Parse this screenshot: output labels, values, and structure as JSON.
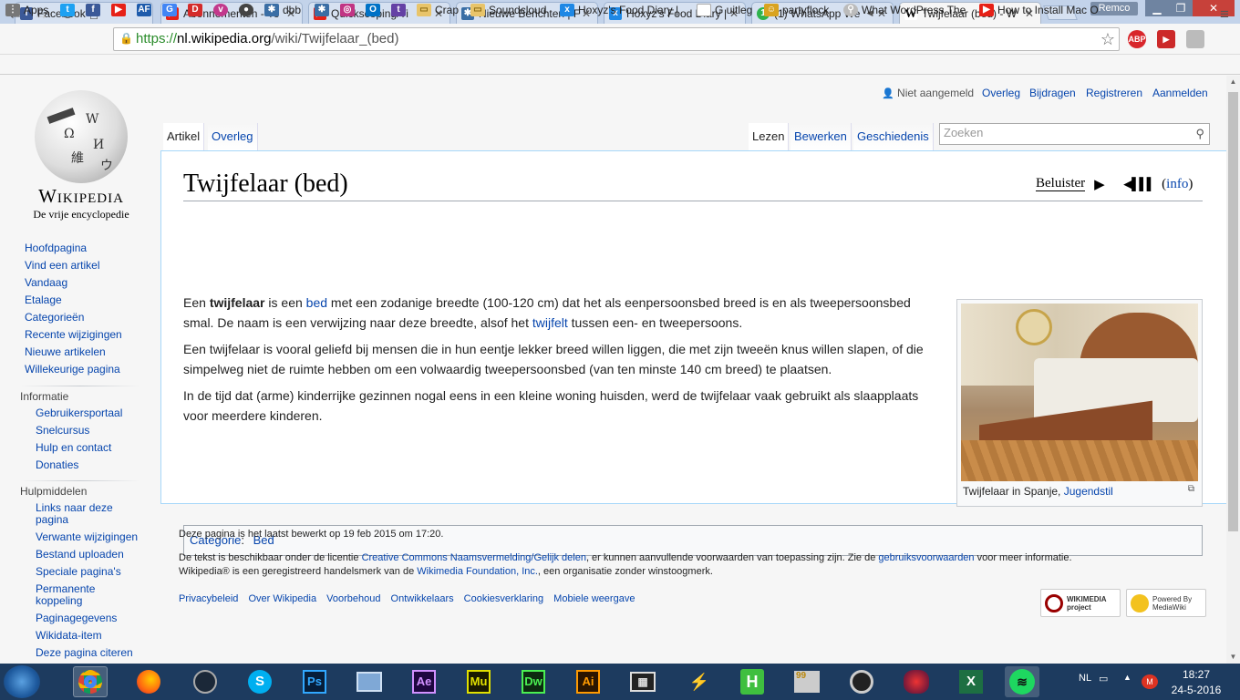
{
  "browser": {
    "tabs": [
      {
        "title": "Facebook",
        "favicon_color": "#3b5998",
        "favicon_letter": "f"
      },
      {
        "title": "Abonnementen - Yo",
        "favicon_color": "#e62117",
        "favicon_letter": "▶"
      },
      {
        "title": "Quickscoping/Ti",
        "favicon_color": "#e62117",
        "favicon_letter": "▶"
      },
      {
        "title": "Nieuwe Berichten | F",
        "favicon_color": "#3a6ea5",
        "favicon_letter": "✱"
      },
      {
        "title": "Hoxyz's Food Diary | ",
        "favicon_color": "#1e88e5",
        "favicon_letter": "x"
      },
      {
        "title": "(1) WhatsApp We",
        "favicon_color": "#2fb34d",
        "favicon_letter": "1"
      },
      {
        "title": "Twijfelaar (bed) - W",
        "favicon_color": "#ffffff",
        "favicon_letter": "W"
      }
    ],
    "profile_name": "Remco",
    "url": {
      "scheme": "https://",
      "domain": "nl.wikipedia.org",
      "path": "/wiki/Twijfelaar_(bed)"
    },
    "bookmarks": [
      {
        "label": "Apps"
      },
      {
        "label": "dbb"
      },
      {
        "label": "Crap"
      },
      {
        "label": "Soundcloud"
      },
      {
        "label": "Hoxyz's Food Diary | "
      },
      {
        "label": "G uitleg"
      },
      {
        "label": "partyflock"
      },
      {
        "label": "What WordPress The"
      },
      {
        "label": "How to Install Mac O"
      }
    ]
  },
  "wiki": {
    "logo_title": "Wikipedia",
    "logo_subtitle": "De vrije encyclopedie",
    "personal": {
      "not_logged": "Niet aangemeld",
      "talk": "Overleg",
      "contributions": "Bijdragen",
      "register": "Registreren",
      "login": "Aanmelden"
    },
    "tabs": {
      "article": "Artikel",
      "talk": "Overleg",
      "read": "Lezen",
      "edit": "Bewerken",
      "history": "Geschiedenis"
    },
    "search_placeholder": "Zoeken",
    "nav_main": [
      "Hoofdpagina",
      "Vind een artikel",
      "Vandaag",
      "Etalage",
      "Categorieën",
      "Recente wijzigingen",
      "Nieuwe artikelen",
      "Willekeurige pagina"
    ],
    "info_heading": "Informatie",
    "nav_info": [
      "Gebruikersportaal",
      "Snelcursus",
      "Hulp en contact",
      "Donaties"
    ],
    "tools_heading": "Hulpmiddelen",
    "nav_tools": [
      "Links naar deze pagina",
      "Verwante wijzigingen",
      "Bestand uploaden",
      "Speciale pagina's",
      "Permanente koppeling",
      "Paginagegevens",
      "Wikidata-item",
      "Deze pagina citeren"
    ],
    "title": "Twijfelaar (bed)",
    "listen": {
      "label": "Beluister",
      "info": "info"
    },
    "p1": {
      "a": "Een ",
      "bold": "twijfelaar",
      "b": " is een ",
      "link1": "bed",
      "c": " met een zodanige breedte (100-120 cm) dat het als eenpersoonsbed breed is en als tweepersoonsbed smal. De naam is een verwijzing naar deze breedte, alsof het ",
      "link2": "twijfelt",
      "d": " tussen een- en tweepersoons."
    },
    "p2": "Een twijfelaar is vooral geliefd bij mensen die in hun eentje lekker breed willen liggen, die met zijn tweeën knus willen slapen, of die simpelweg niet de ruimte hebben om een volwaardig tweepersoonsbed (van ten minste 140 cm breed) te plaatsen.",
    "p3": "In de tijd dat (arme) kinderrijke gezinnen nogal eens in een kleine woning huisden, werd de twijfelaar vaak gebruikt als slaapplaats voor meerdere kinderen.",
    "caption": {
      "text": "Twijfelaar in Spanje, ",
      "link": "Jugendstil"
    },
    "category": {
      "label": "Categorie",
      "value": "Bed"
    },
    "footer": {
      "last_edit": "Deze pagina is het laatst bewerkt op 19 feb 2015 om 17:20.",
      "license_a": "De tekst is beschikbaar onder de licentie ",
      "license_link": "Creative Commons Naamsvermelding/Gelijk delen",
      "license_b": ", er kunnen aanvullende voorwaarden van toepassing zijn. Zie de ",
      "terms_link": "gebruiksvoorwaarden",
      "license_c": " voor meer informatie.",
      "tm_a": "Wikipedia® is een geregistreerd handelsmerk van de ",
      "tm_link": "Wikimedia Foundation, Inc.",
      "tm_b": ", een organisatie zonder winstoogmerk.",
      "links": [
        "Privacybeleid",
        "Over Wikipedia",
        "Voorbehoud",
        "Ontwikkelaars",
        "Cookiesverklaring",
        "Mobiele weergave"
      ],
      "badge1": "WIKIMEDIA project",
      "badge2": "Powered By MediaWiki"
    }
  },
  "taskbar": {
    "apps": [
      "Chrome",
      "Firefox",
      "Steam",
      "Skype",
      "Ps",
      "Network",
      "Ae",
      "Mu",
      "Dw",
      "Ai",
      "Video",
      "Game",
      "H",
      "99",
      "Razer",
      "Game2",
      "Excel",
      "Spotify"
    ],
    "lang": "NL",
    "time": "18:27",
    "date": "24-5-2016"
  },
  "colors": {
    "link": "#0645ad",
    "tabbar": "#c3d3ea",
    "taskbar": "#1d3b5f"
  }
}
